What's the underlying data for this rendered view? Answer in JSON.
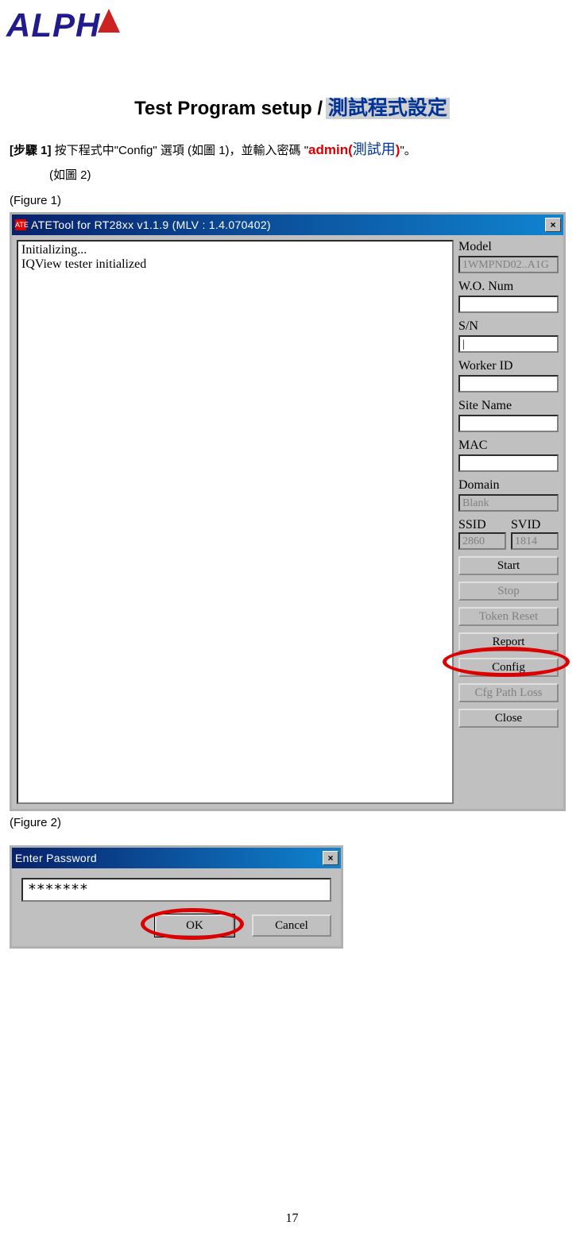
{
  "logo": "ALPHA",
  "title_en": "Test Program setup /",
  "title_zh": "測試程式設定",
  "step1_label": "[步驟 1]",
  "step1_text_a": "按下程式中\"Config\" 選項 (如圖 1)，並輸入密碼 \"",
  "step1_admin": "admin(",
  "step1_admin_zh": "測試用",
  "step1_admin_close": ")",
  "step1_quote_end": "\"。",
  "step1_text_b": "(如圖 2)",
  "figure1": "(Figure 1)",
  "figure2": "(Figure 2)",
  "window1": {
    "title": "ATETool for RT28xx v1.1.9 (MLV : 1.4.070402)",
    "console_line1": "Initializing...",
    "console_line2": "IQView tester initialized",
    "labels": {
      "model": "Model",
      "wo": "W.O. Num",
      "sn": "S/N",
      "worker": "Worker ID",
      "site": "Site Name",
      "mac": "MAC",
      "domain": "Domain",
      "ssid": "SSID",
      "svid": "SVID"
    },
    "values": {
      "model": "1WMPND02..A1G",
      "domain": "Blank",
      "ssid": "2860",
      "svid": "1814"
    },
    "buttons": {
      "start": "Start",
      "stop": "Stop",
      "token": "Token Reset",
      "report": "Report",
      "config": "Config",
      "cfg": "Cfg Path Loss",
      "close": "Close"
    }
  },
  "window2": {
    "title": "Enter Password",
    "value": "*******",
    "ok": "OK",
    "cancel": "Cancel"
  },
  "pagenum": "17"
}
